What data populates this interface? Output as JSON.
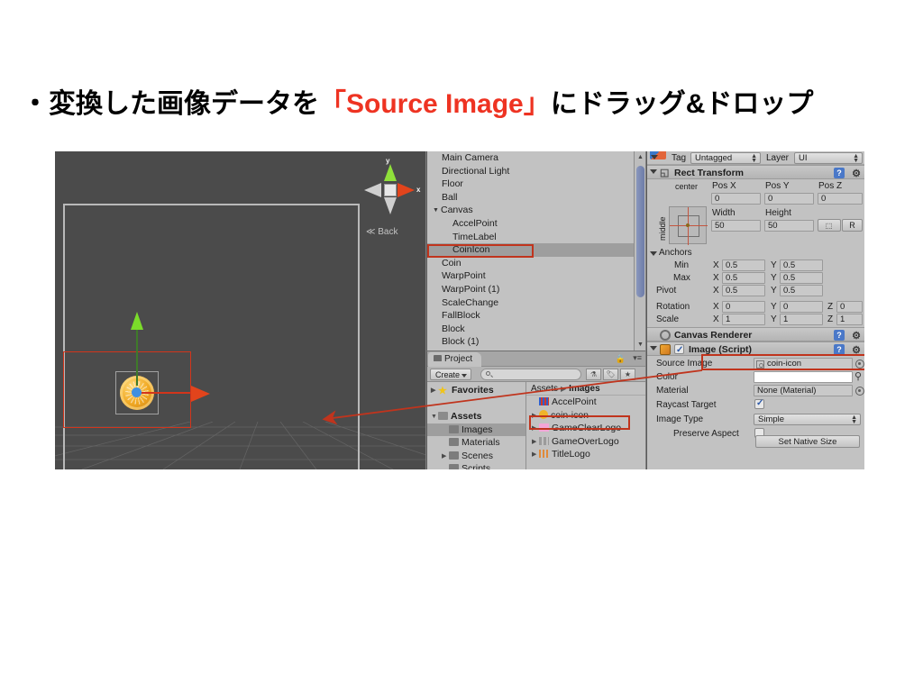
{
  "slide": {
    "title_bullet": "・",
    "title_pre": "変換した画像データを",
    "title_highlight": "「Source Image」",
    "title_post": "にドラッグ&ドロップ",
    "highlight_color": "#ee3322"
  },
  "scene_view": {
    "back_label": "≪ Back",
    "gizmo_axis_x": "x",
    "gizmo_axis_y": "y"
  },
  "hierarchy": {
    "items": [
      {
        "label": "Main Camera",
        "indent": 0,
        "arrow": "",
        "selected": false
      },
      {
        "label": "Directional Light",
        "indent": 0,
        "arrow": "",
        "selected": false
      },
      {
        "label": "Floor",
        "indent": 0,
        "arrow": "",
        "selected": false
      },
      {
        "label": "Ball",
        "indent": 0,
        "arrow": "",
        "selected": false
      },
      {
        "label": "Canvas",
        "indent": 0,
        "arrow": "▼",
        "selected": false
      },
      {
        "label": "AccelPoint",
        "indent": 1,
        "arrow": "",
        "selected": false
      },
      {
        "label": "TimeLabel",
        "indent": 1,
        "arrow": "",
        "selected": false
      },
      {
        "label": "CoinIcon",
        "indent": 1,
        "arrow": "",
        "selected": true
      },
      {
        "label": "Coin",
        "indent": 0,
        "arrow": "",
        "selected": false
      },
      {
        "label": "WarpPoint",
        "indent": 0,
        "arrow": "",
        "selected": false
      },
      {
        "label": "WarpPoint (1)",
        "indent": 0,
        "arrow": "",
        "selected": false
      },
      {
        "label": "ScaleChange",
        "indent": 0,
        "arrow": "",
        "selected": false
      },
      {
        "label": "FallBlock",
        "indent": 0,
        "arrow": "",
        "selected": false
      },
      {
        "label": "Block",
        "indent": 0,
        "arrow": "",
        "selected": false
      },
      {
        "label": "Block (1)",
        "indent": 0,
        "arrow": "",
        "selected": false
      }
    ]
  },
  "project": {
    "tab_label": "Project",
    "create_label": "Create",
    "search_value": "",
    "search_placeholder": "",
    "breadcrumb_root": "Assets",
    "breadcrumb_sep": "▶",
    "breadcrumb_current": "Images",
    "tree": [
      {
        "label": "Favorites",
        "icon": "star",
        "tri": "▶",
        "indent": 0,
        "bold": true,
        "selected": false
      },
      {
        "label": "",
        "icon": "none",
        "tri": "",
        "indent": 0,
        "bold": false,
        "selected": false
      },
      {
        "label": "Assets",
        "icon": "folder-open",
        "tri": "▼",
        "indent": 0,
        "bold": true,
        "selected": false
      },
      {
        "label": "Images",
        "icon": "folder",
        "tri": "",
        "indent": 1,
        "bold": false,
        "selected": true
      },
      {
        "label": "Materials",
        "icon": "folder",
        "tri": "",
        "indent": 1,
        "bold": false,
        "selected": false
      },
      {
        "label": "Scenes",
        "icon": "folder",
        "tri": "▶",
        "indent": 1,
        "bold": false,
        "selected": false
      },
      {
        "label": "Scripts",
        "icon": "folder",
        "tri": "",
        "indent": 1,
        "bold": false,
        "selected": false
      }
    ],
    "assets": [
      {
        "label": "AccelPoint",
        "icon": "accel",
        "tri": "",
        "highlighted": false
      },
      {
        "label": "coin-icon",
        "icon": "coin",
        "tri": "▶",
        "highlighted": true
      },
      {
        "label": "GameClearLogo",
        "icon": "gclear",
        "tri": "▶",
        "highlighted": false
      },
      {
        "label": "GameOverLogo",
        "icon": "gover",
        "tri": "▶",
        "highlighted": false
      },
      {
        "label": "TitleLogo",
        "icon": "title",
        "tri": "▶",
        "highlighted": false
      }
    ]
  },
  "inspector": {
    "tag_label": "Tag",
    "tag_value": "Untagged",
    "layer_label": "Layer",
    "layer_value": "UI",
    "rect_transform": {
      "header": "Rect Transform",
      "anchor_preset_h": "center",
      "anchor_preset_v": "middle",
      "pos_x_label": "Pos X",
      "pos_x_value": "0",
      "pos_y_label": "Pos Y",
      "pos_y_value": "0",
      "pos_z_label": "Pos Z",
      "pos_z_value": "0",
      "width_label": "Width",
      "width_value": "50",
      "height_label": "Height",
      "height_value": "50",
      "blueprint_btn": "",
      "raw_btn": "R"
    },
    "anchors": {
      "header": "Anchors",
      "min_label": "Min",
      "min_x": "0.5",
      "min_y": "0.5",
      "max_label": "Max",
      "max_x": "0.5",
      "max_y": "0.5",
      "pivot_label": "Pivot",
      "pivot_x": "0.5",
      "pivot_y": "0.5",
      "rotation_label": "Rotation",
      "rot_x": "0",
      "rot_y": "0",
      "rot_z": "0",
      "scale_label": "Scale",
      "scale_x": "1",
      "scale_y": "1",
      "scale_z": "1",
      "axis_x": "X",
      "axis_y": "Y",
      "axis_z": "Z"
    },
    "canvas_renderer": {
      "header": "Canvas Renderer"
    },
    "image_script": {
      "header": "Image (Script)",
      "enabled": true,
      "source_image_label": "Source Image",
      "source_image_value": "coin-icon",
      "color_label": "Color",
      "color_value": "",
      "material_label": "Material",
      "material_value": "None (Material)",
      "raycast_label": "Raycast Target",
      "raycast_checked": true,
      "image_type_label": "Image Type",
      "image_type_value": "Simple",
      "preserve_aspect_label": "Preserve Aspect",
      "preserve_aspect_checked": false,
      "set_native_size_label": "Set Native Size"
    }
  },
  "annotations": {
    "highlight_color": "#c0341d",
    "targets": [
      "hierarchy-coinicon",
      "project-coin-icon",
      "inspector-source-image"
    ]
  }
}
